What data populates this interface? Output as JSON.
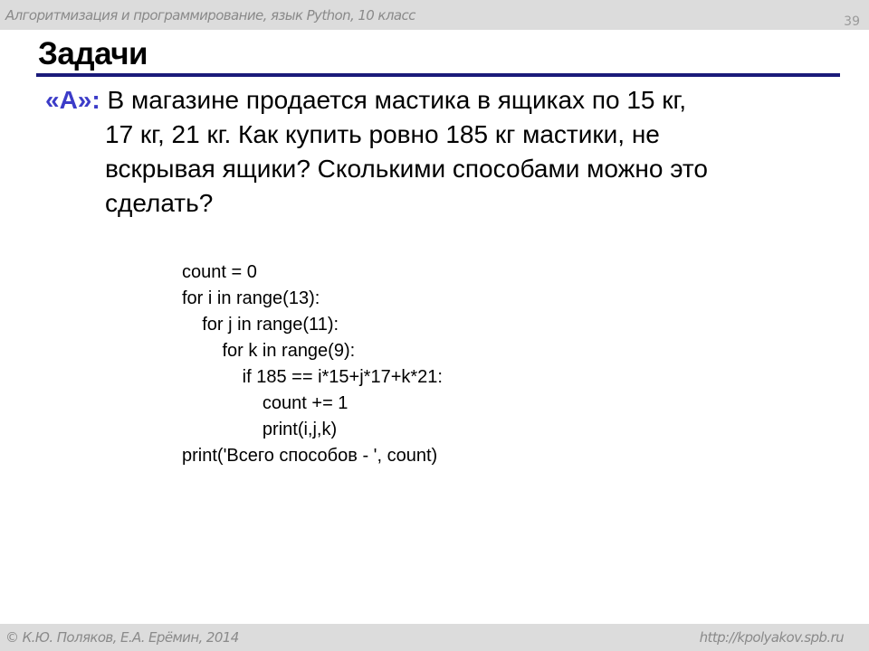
{
  "header": {
    "course": "Алгоритмизация и программирование, язык Python, 10 класс",
    "page_number": "39"
  },
  "title": "Задачи",
  "task": {
    "label": "«A»:",
    "lines": [
      "В магазине продается мастика в ящиках по 15 кг,",
      "17 кг, 21 кг. Как купить ровно 185 кг мастики, не",
      "вскрывая ящики? Сколькими способами можно это",
      "сделать?"
    ]
  },
  "code": [
    "count = 0",
    "for i in range(13):",
    "    for j in range(11):",
    "        for k in range(9):",
    "            if 185 == i*15+j*17+k*21:",
    "                count += 1",
    "                print(i,j,k)",
    "print('Всего способов - ', count)"
  ],
  "footer": {
    "copyright": "© К.Ю. Поляков, Е.А. Ерёмин, 2014",
    "url": "http://kpolyakov.spb.ru"
  },
  "colors": {
    "accent": "#3c3cc8",
    "rule": "#1a1a7a",
    "bars": "#dcdcdc"
  }
}
